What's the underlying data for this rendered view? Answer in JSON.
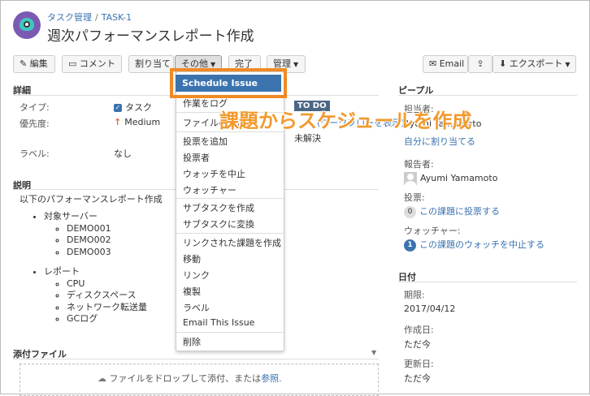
{
  "header": {
    "breadcrumb_project": "タスク管理",
    "breadcrumb_sep": "/",
    "breadcrumb_issue": "TASK-1",
    "title": "週次パフォーマンスレポート作成"
  },
  "toolbar": {
    "edit": "編集",
    "comment": "コメント",
    "assign": "割り当て",
    "more": "その他",
    "done": "完了",
    "admin": "管理",
    "email": "Email",
    "export": "エクスポート"
  },
  "details": {
    "section": "詳細",
    "type_label": "タイプ:",
    "type_value": "タスク",
    "priority_label": "優先度:",
    "priority_value": "Medium",
    "label_label": "ラベル:",
    "label_value": "なし",
    "status": "TO DO",
    "resolution_partial": "(ワークフローを表示)",
    "resolution_value": "未解決",
    "file_partial": "ファイルの"
  },
  "description": {
    "section": "説明",
    "intro": "以下のパフォーマンスレポート作成",
    "items": [
      {
        "label": "対象サーバー",
        "children": [
          "DEMO001",
          "DEMO002",
          "DEMO003"
        ]
      },
      {
        "label": "レポート",
        "children": [
          "CPU",
          "ディスクスペース",
          "ネットワーク転送量",
          "GCログ"
        ]
      }
    ]
  },
  "attachments": {
    "section": "添付ファイル",
    "drop_text": "ファイルをドロップして添付、または",
    "browse": "参照."
  },
  "menu": {
    "highlighted": "Schedule Issue",
    "items": [
      "作業をログ",
      "ファイルの添付",
      "投票を追加",
      "投票者",
      "ウォッチを中止",
      "ウォッチャー",
      "サブタスクを作成",
      "サブタスクに変換",
      "リンクされた課題を作成",
      "移動",
      "リンク",
      "複製",
      "ラベル",
      "Email This Issue",
      "削除"
    ]
  },
  "annotation": "課題からスケジュールを作成",
  "people": {
    "section": "ピープル",
    "assignee_label": "担当者:",
    "assignee_value": "Ayumi Yamamoto",
    "assign_to_me": "自分に割り当てる",
    "reporter_label": "報告者:",
    "reporter_value": "Ayumi Yamamoto",
    "votes_label": "投票:",
    "votes_count": "0",
    "vote_link": "この課題に投票する",
    "watchers_label": "ウォッチャー:",
    "watchers_count": "1",
    "watch_link": "この課題のウォッチを中止する"
  },
  "dates": {
    "section": "日付",
    "due_label": "期限:",
    "due_value": "2017/04/12",
    "created_label": "作成日:",
    "created_value": "ただ今",
    "updated_label": "更新日:",
    "updated_value": "ただ今"
  }
}
